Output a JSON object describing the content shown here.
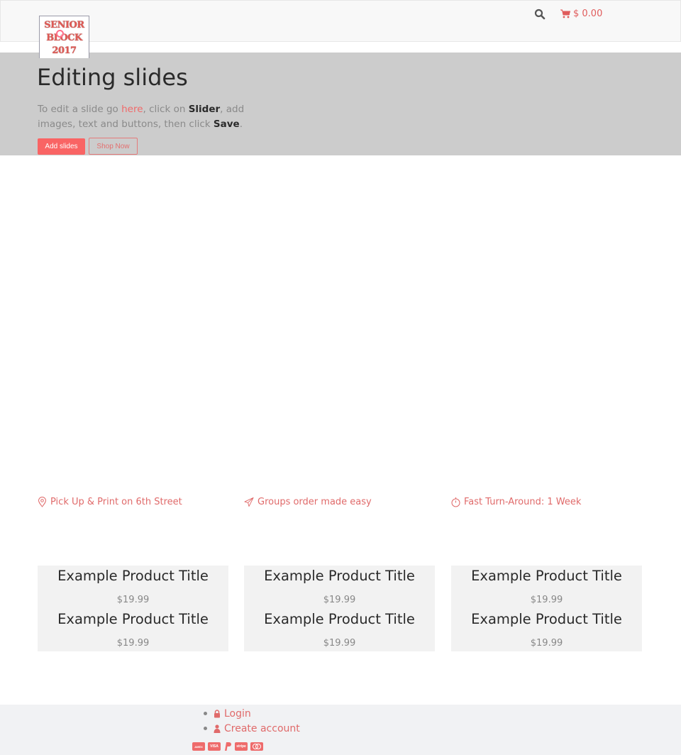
{
  "header": {
    "logo": {
      "lines": [
        "SENIOR",
        "BLOCK",
        "2017"
      ]
    },
    "search_icon": "search-icon",
    "cart": {
      "icon": "shopping-cart-icon",
      "total": "$ 0.00"
    }
  },
  "slider": {
    "title": "Editing slides",
    "desc": {
      "part1": "To edit a slide go ",
      "link": "here",
      "part2": ", click on ",
      "bold1": "Slider",
      "part3": ", add images, text and buttons, then click ",
      "bold2": "Save",
      "part4": "."
    },
    "buttons": {
      "add": "Add slides",
      "shop": "Shop Now"
    }
  },
  "features": [
    {
      "icon": "map-pin-icon",
      "label": "Pick Up & Print on 6th Street"
    },
    {
      "icon": "paper-plane-icon",
      "label": "Groups order made easy"
    },
    {
      "icon": "stopwatch-icon",
      "label": "Fast Turn-Around: 1 Week"
    }
  ],
  "products": [
    [
      {
        "title": "Example Product Title",
        "price": "$19.99"
      },
      {
        "title": "Example Product Title",
        "price": "$19.99"
      }
    ],
    [
      {
        "title": "Example Product Title",
        "price": "$19.99"
      },
      {
        "title": "Example Product Title",
        "price": "$19.99"
      }
    ],
    [
      {
        "title": "Example Product Title",
        "price": "$19.99"
      },
      {
        "title": "Example Product Title",
        "price": "$19.99"
      }
    ]
  ],
  "footer": {
    "links": [
      {
        "icon": "lock-icon",
        "label": "Login"
      },
      {
        "icon": "user-icon",
        "label": "Create account"
      }
    ],
    "payments": [
      {
        "name": "american-express-icon",
        "label": "AMEX"
      },
      {
        "name": "visa-icon",
        "label": "VISA"
      },
      {
        "name": "paypal-icon",
        "label": "P"
      },
      {
        "name": "stripe-icon",
        "label": "stripe"
      },
      {
        "name": "mastercard-icon",
        "label": ""
      }
    ]
  },
  "colors": {
    "accent": "#f96464",
    "link": "#e06a6a",
    "slider_bg": "#cccccc",
    "header_bg": "#f8f8f8",
    "product_bg": "#f2f2f2",
    "footer_bg": "#f1f2f4"
  }
}
